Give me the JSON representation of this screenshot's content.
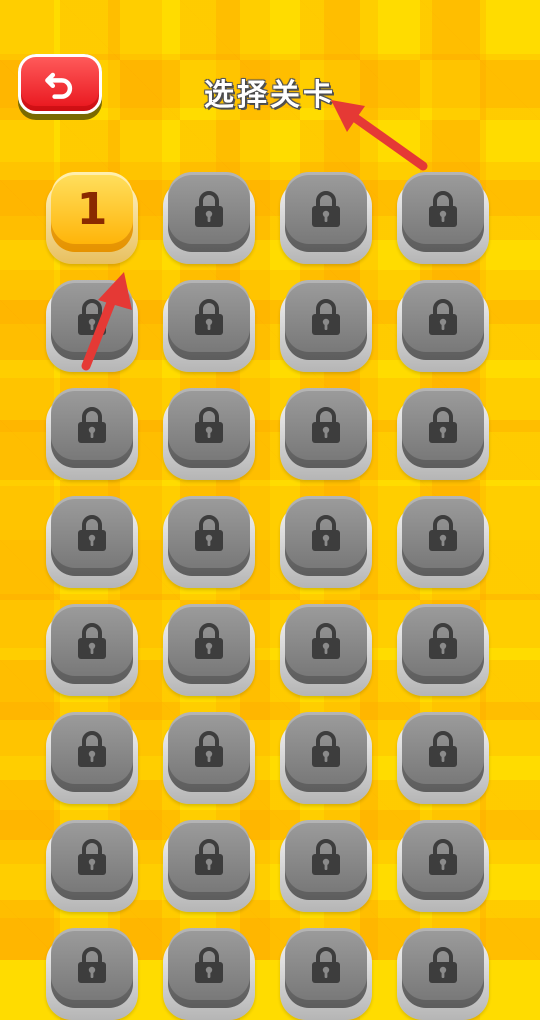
{
  "header": {
    "title": "选择关卡",
    "back_icon": "back-arrow-icon"
  },
  "levels": [
    {
      "label": "1",
      "locked": false
    },
    {
      "label": "",
      "locked": true
    },
    {
      "label": "",
      "locked": true
    },
    {
      "label": "",
      "locked": true
    },
    {
      "label": "",
      "locked": true
    },
    {
      "label": "",
      "locked": true
    },
    {
      "label": "",
      "locked": true
    },
    {
      "label": "",
      "locked": true
    },
    {
      "label": "",
      "locked": true
    },
    {
      "label": "",
      "locked": true
    },
    {
      "label": "",
      "locked": true
    },
    {
      "label": "",
      "locked": true
    },
    {
      "label": "",
      "locked": true
    },
    {
      "label": "",
      "locked": true
    },
    {
      "label": "",
      "locked": true
    },
    {
      "label": "",
      "locked": true
    },
    {
      "label": "",
      "locked": true
    },
    {
      "label": "",
      "locked": true
    },
    {
      "label": "",
      "locked": true
    },
    {
      "label": "",
      "locked": true
    },
    {
      "label": "",
      "locked": true
    },
    {
      "label": "",
      "locked": true
    },
    {
      "label": "",
      "locked": true
    },
    {
      "label": "",
      "locked": true
    },
    {
      "label": "",
      "locked": true
    },
    {
      "label": "",
      "locked": true
    },
    {
      "label": "",
      "locked": true
    },
    {
      "label": "",
      "locked": true
    },
    {
      "label": "",
      "locked": true
    },
    {
      "label": "",
      "locked": true
    },
    {
      "label": "",
      "locked": true
    },
    {
      "label": "",
      "locked": true
    }
  ],
  "colors": {
    "background": "#ffdc00",
    "back_button": "#e8141c",
    "unlocked_level": "#ffc000",
    "locked_level": "#8a8a8a",
    "annotation_arrow": "#e53935"
  }
}
